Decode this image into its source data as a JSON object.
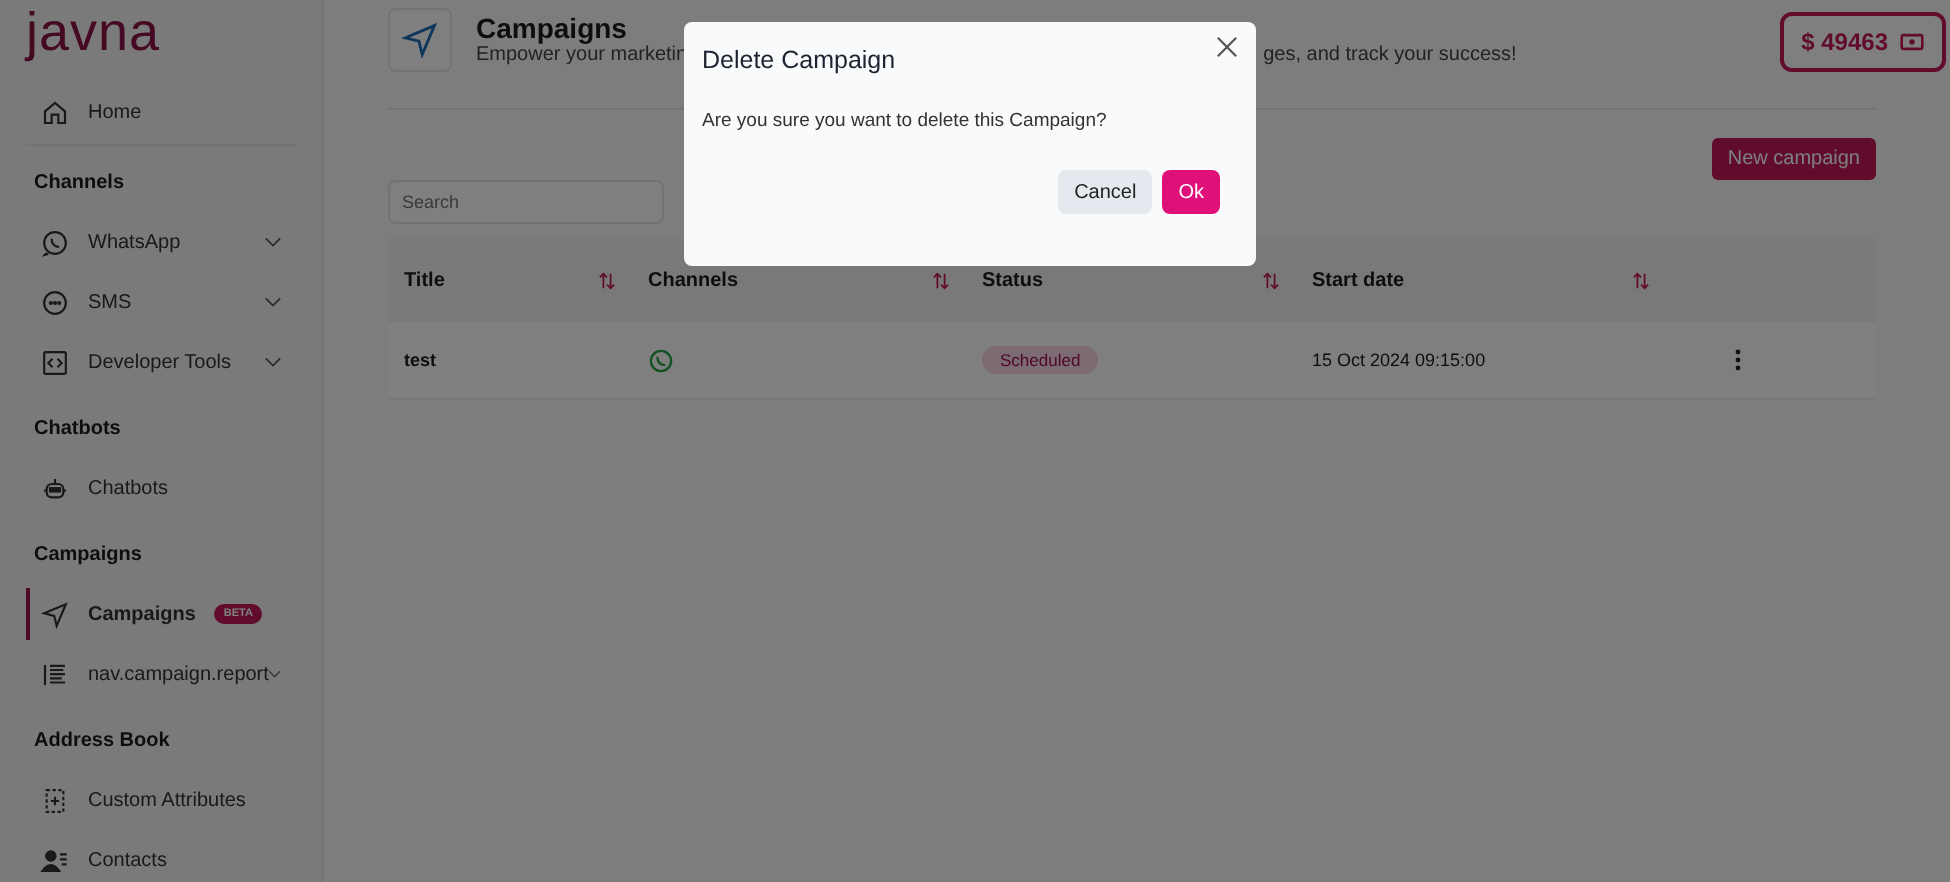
{
  "logo": "javna",
  "sidebar": {
    "items": [
      {
        "kind": "link",
        "label": "Home",
        "selected": false
      },
      {
        "kind": "heading",
        "label": "Channels"
      },
      {
        "kind": "group",
        "label": "WhatsApp",
        "expanded": false
      },
      {
        "kind": "group",
        "label": "SMS",
        "expanded": false
      },
      {
        "kind": "group",
        "label": "Developer Tools",
        "expanded": false
      },
      {
        "kind": "heading",
        "label": "Chatbots"
      },
      {
        "kind": "link",
        "label": "Chatbots",
        "selected": false
      },
      {
        "kind": "heading",
        "label": "Campaigns"
      },
      {
        "kind": "link",
        "label": "Campaigns",
        "selected": true,
        "badge": "BETA"
      },
      {
        "kind": "group",
        "label": "nav.campaign.report",
        "expanded": false
      },
      {
        "kind": "heading",
        "label": "Address Book"
      },
      {
        "kind": "link",
        "label": "Custom Attributes",
        "selected": false
      },
      {
        "kind": "link",
        "label": "Contacts",
        "selected": false
      }
    ]
  },
  "header": {
    "title": "Campaigns",
    "subtitle_start": "Empower your marketin",
    "subtitle_end": "ges, and track your success!"
  },
  "balance": "$ 49463",
  "new_button": "New campaign",
  "search": {
    "placeholder": "Search"
  },
  "table": {
    "columns": [
      {
        "label": "Title",
        "sortable": true
      },
      {
        "label": "Channels",
        "sortable": true
      },
      {
        "label": "Status",
        "sortable": true
      },
      {
        "label": "Start date",
        "sortable": true
      }
    ],
    "rows": [
      {
        "title": "test",
        "status": "Scheduled",
        "start_date": "15 Oct 2024 09:15:00"
      }
    ]
  },
  "dialog": {
    "title": "Delete Campaign",
    "message": "Are you sure you want to delete this Campaign?",
    "cancel": "Cancel",
    "ok": "Ok"
  }
}
